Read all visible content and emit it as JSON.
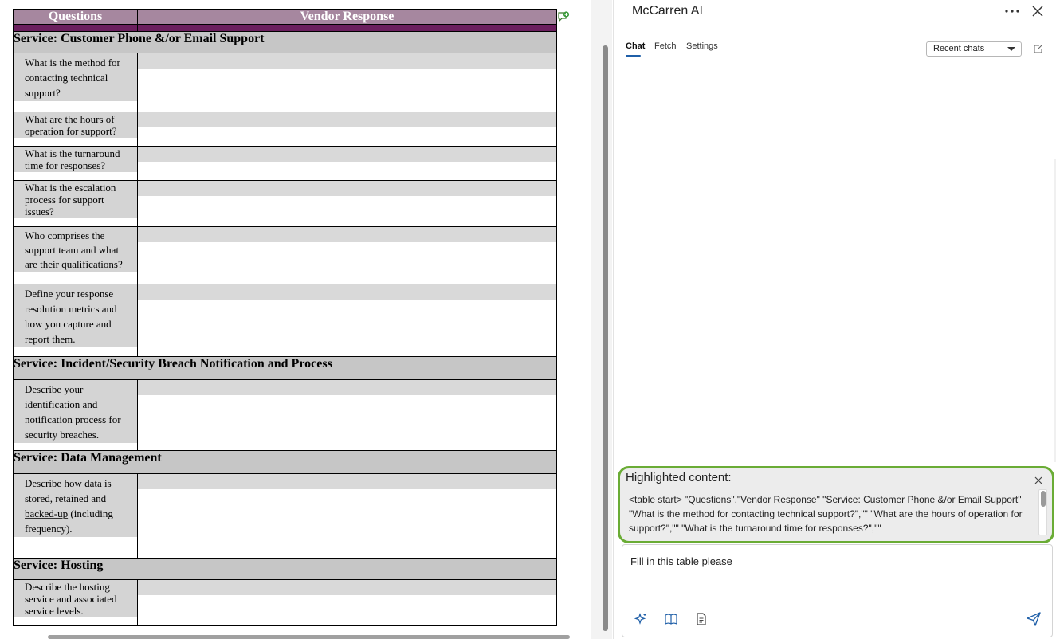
{
  "document": {
    "headers": {
      "questions": "Questions",
      "vendor_response": "Vendor Response"
    },
    "sections": [
      {
        "title": "Service: Customer Phone &/or Email Support",
        "questions": [
          "What is the method for contacting technical support?",
          "What are the hours of operation for support?",
          "What is the turnaround time for responses?",
          "What is the escalation process for support issues?",
          "Who comprises the support team and what are their qualifications?",
          "Define your response resolution metrics and how you capture and report them."
        ]
      },
      {
        "title": "Service: Incident/Security Breach Notification and Process",
        "questions": [
          "Describe your identification and notification process for security breaches."
        ]
      },
      {
        "title": "Service: Data Management",
        "questions": [
          "Describe how data is stored, retained and backed-up (including frequency)."
        ]
      },
      {
        "title": "Service: Hosting",
        "questions": [
          "Describe the hosting service and associated service levels."
        ]
      }
    ]
  },
  "panel": {
    "title": "McCarren AI",
    "tabs": [
      "Chat",
      "Fetch",
      "Settings"
    ],
    "recent_chats": "Recent chats",
    "highlight": {
      "title": "Highlighted content:",
      "text": "<table start> \"Questions\",\"Vendor Response\" \"Service: Customer Phone &/or Email Support\" \"What is the method for contacting technical support?\",\"\" \"What are the hours of operation for support?\",\"\" \"What is the turnaround time for responses?\",\"\""
    },
    "input_value": "Fill in this table please"
  },
  "icons": {
    "comment": "add-comment-icon",
    "more": "more-options-icon",
    "close": "close-icon",
    "new_chat": "new-chat-icon",
    "sparkle": "sparkle-icon",
    "book": "book-icon",
    "document": "document-icon",
    "send": "send-icon"
  },
  "colors": {
    "table_header": "#a6879f",
    "table_header_bar": "#6b1f5e",
    "section_fill": "#c6c6c6",
    "highlight_border": "#6aac35",
    "accent_blue": "#1f5fa8"
  }
}
